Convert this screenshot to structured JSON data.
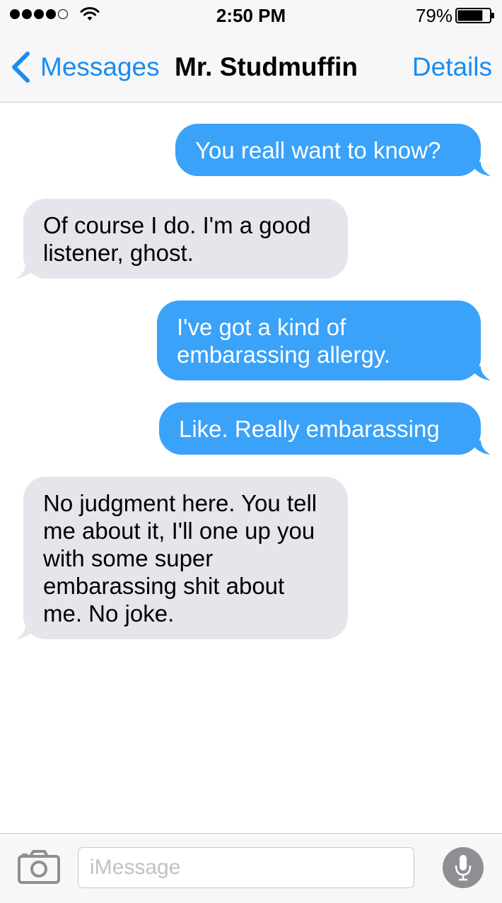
{
  "status_bar": {
    "signal_bars": 4,
    "signal_total": 5,
    "time": "2:50 PM",
    "battery_percent": "79%",
    "battery_level": 0.79
  },
  "nav": {
    "back_label": "Messages",
    "title": "Mr. Studmuffin",
    "details_label": "Details"
  },
  "messages": [
    {
      "direction": "sent",
      "text": "You reall want to know?"
    },
    {
      "direction": "received",
      "text": "Of course I do. I'm a good listener, ghost."
    },
    {
      "direction": "sent",
      "text": "I've got a kind of embarassing allergy."
    },
    {
      "direction": "sent",
      "text": "Like. Really embarassing"
    },
    {
      "direction": "received",
      "text": "No judgment here. You tell me about it, I'll one up you with some super embarassing shit about me. No joke."
    }
  ],
  "input": {
    "placeholder": "iMessage",
    "value": ""
  },
  "icons": {
    "back": "chevron-left-icon",
    "camera": "camera-icon",
    "mic": "microphone-icon",
    "wifi": "wifi-icon",
    "battery": "battery-icon"
  },
  "colors": {
    "accent": "#1a8cf0",
    "sent_bubble": "#3aa2f8",
    "received_bubble": "#e6e5eb"
  }
}
